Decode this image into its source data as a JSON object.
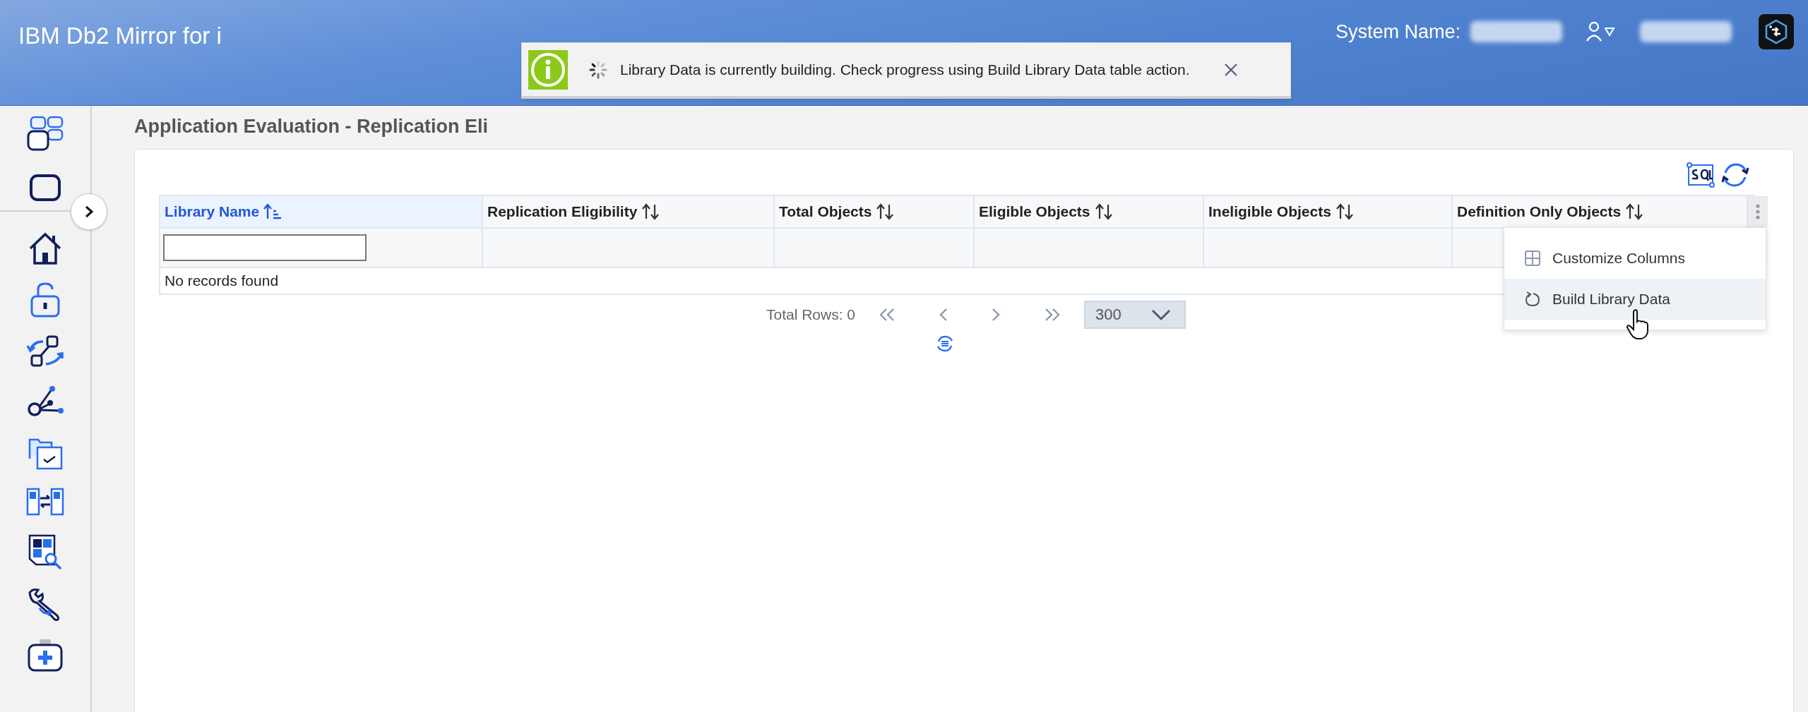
{
  "header": {
    "title": "IBM Db2 Mirror for i",
    "system_name_label": "System Name:"
  },
  "toast": {
    "message": "Library Data is currently building. Check progress using Build Library Data table action."
  },
  "page": {
    "title": "Application Evaluation - Replication Eli"
  },
  "table": {
    "columns": [
      {
        "label": "Library Name",
        "sorted": true
      },
      {
        "label": "Replication Eligibility",
        "sorted": false
      },
      {
        "label": "Total Objects",
        "sorted": false
      },
      {
        "label": "Eligible Objects",
        "sorted": false
      },
      {
        "label": "Ineligible Objects",
        "sorted": false
      },
      {
        "label": "Definition Only Objects",
        "sorted": false
      }
    ],
    "empty_message": "No records found"
  },
  "pagination": {
    "total_rows": "Total Rows: 0",
    "page_size": "300"
  },
  "menu": {
    "items": [
      {
        "label": "Customize Columns",
        "kind": "columns",
        "selected": false
      },
      {
        "label": "Build Library Data",
        "kind": "rebuild",
        "selected": true
      }
    ]
  }
}
